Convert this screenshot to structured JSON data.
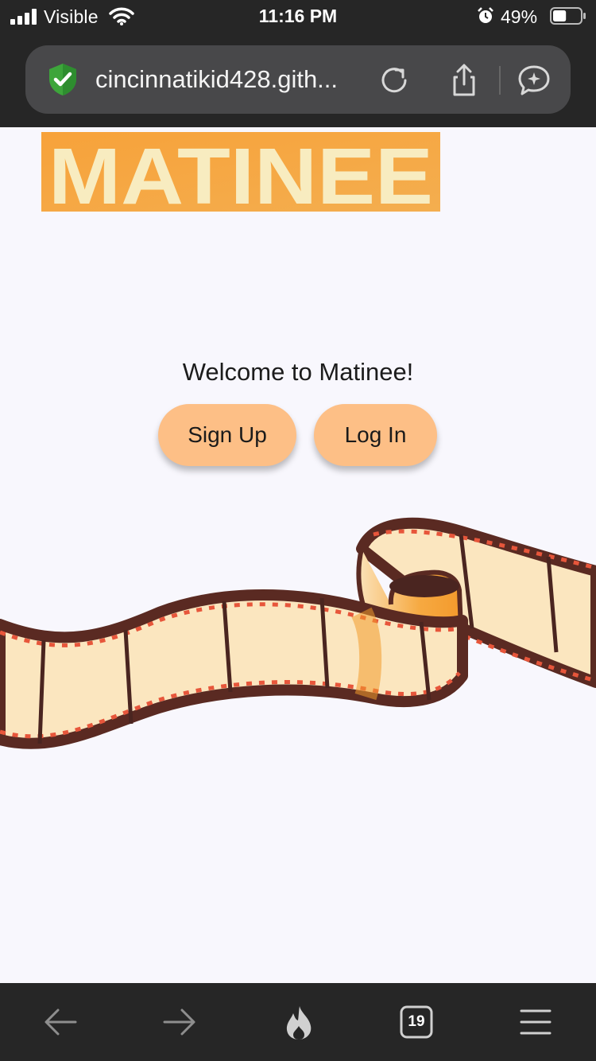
{
  "status_bar": {
    "carrier": "Visible",
    "time": "11:16 PM",
    "battery_percent": "49%",
    "battery_level": 0.49,
    "icons": [
      "signal-icon",
      "wifi-icon",
      "alarm-icon",
      "battery-icon"
    ]
  },
  "browser": {
    "url": "cincinnatikid428.gith...",
    "icons": [
      "shield-check-icon",
      "reload-icon",
      "share-icon",
      "assistant-icon"
    ],
    "tabs_count": "19"
  },
  "page": {
    "logo_text": "MATINEE",
    "welcome": "Welcome to Matinee!",
    "buttons": {
      "signup": "Sign Up",
      "login": "Log In"
    }
  },
  "toolbar": {
    "icons": [
      "back-arrow-icon",
      "forward-arrow-icon",
      "fire-icon",
      "tabs-icon",
      "menu-icon"
    ]
  },
  "colors": {
    "chrome_bg": "#262626",
    "page_bg": "#f8f7fd",
    "button_bg": "#fdbf86",
    "logo_bg": "#f6a43f",
    "logo_text": "#f8ecc0",
    "film_frame": "#5a2a22",
    "film_cell": "#fbe9c3"
  }
}
